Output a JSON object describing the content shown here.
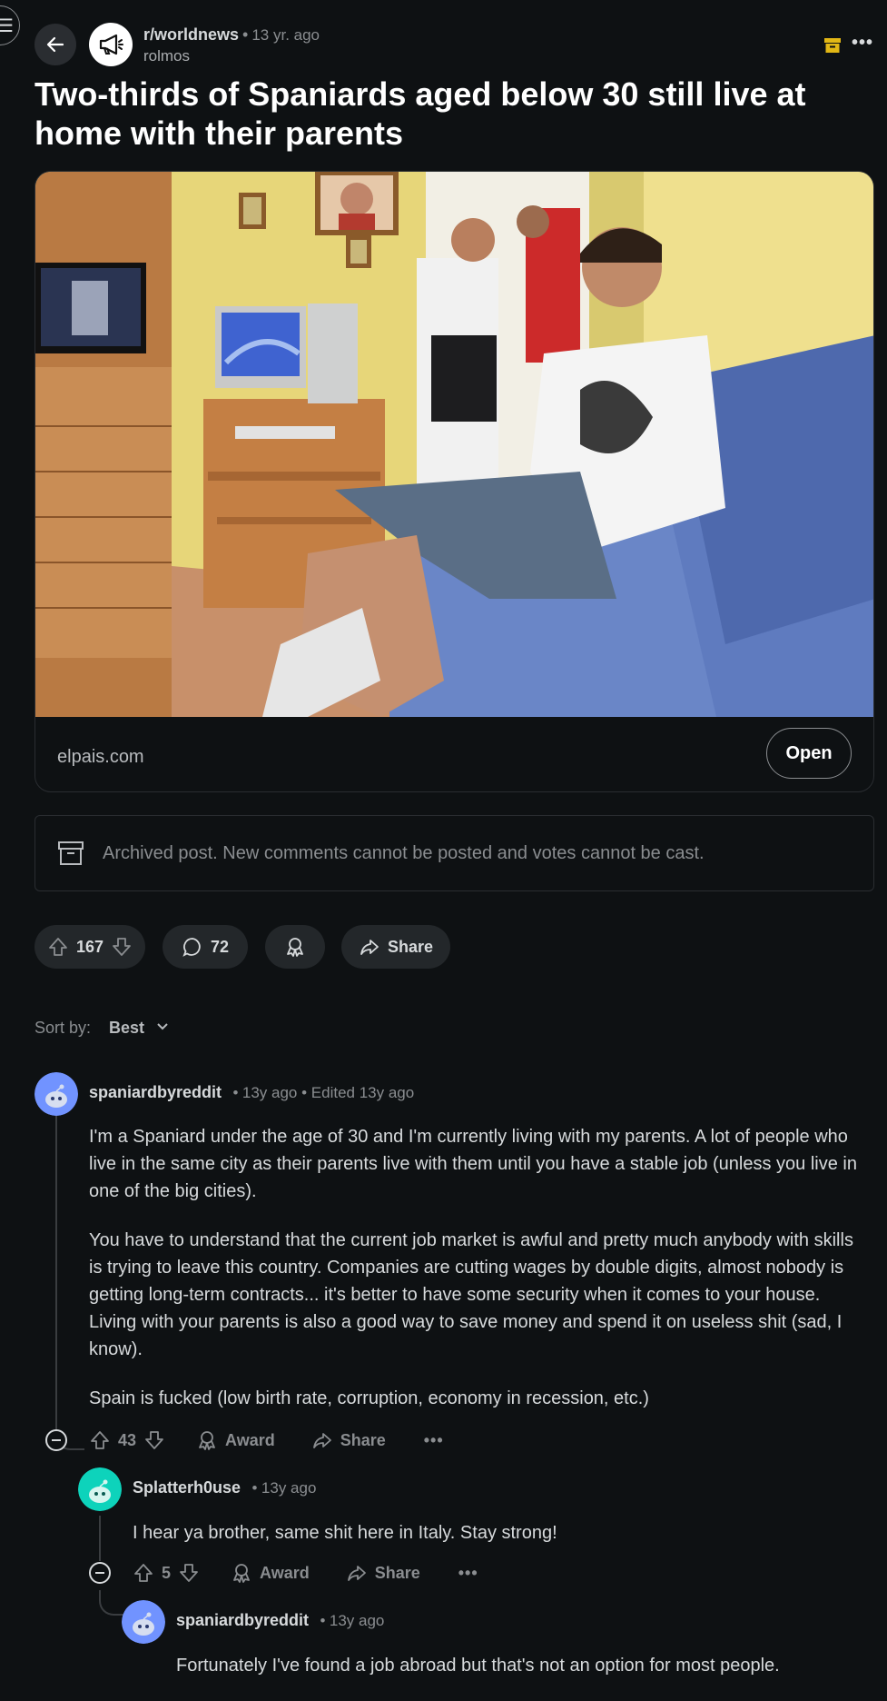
{
  "post": {
    "subreddit": "r/worldnews",
    "time": "13 yr. ago",
    "author": "rolmos",
    "title": "Two-thirds of Spaniards aged below 30 still live at home with their parents",
    "domain": "elpais.com",
    "open_label": "Open",
    "archived_notice": "Archived post. New comments cannot be posted and votes cannot be cast.",
    "votes": "167",
    "comments": "72",
    "share_label": "Share"
  },
  "sort": {
    "label": "Sort by:",
    "value": "Best"
  },
  "comments": [
    {
      "user": "spaniardbyreddit",
      "meta": "13y ago • Edited 13y ago",
      "paragraphs": [
        "I'm a Spaniard under the age of 30 and I'm currently living with my parents. A lot of people who live in the same city as their parents live with them until you have a stable job (unless you live in one of the big cities).",
        "You have to understand that the current job market is awful and pretty much anybody with skills is trying to leave this country. Companies are cutting wages by double digits, almost nobody is getting long-term contracts... it's better to have some security when it comes to your house. Living with your parents is also a good way to save money and spend it on useless shit (sad, I know).",
        "Spain is fucked (low birth rate, corruption, economy in recession, etc.)"
      ],
      "votes": "43",
      "award_label": "Award",
      "share_label": "Share",
      "avatar_color": "#7193ff"
    },
    {
      "user": "Splatterh0use",
      "meta": "13y ago",
      "paragraphs": [
        "I hear ya brother, same shit here in Italy. Stay strong!"
      ],
      "votes": "5",
      "award_label": "Award",
      "share_label": "Share",
      "avatar_color": "#0dd3bb"
    },
    {
      "user": "spaniardbyreddit",
      "meta": "13y ago",
      "paragraphs": [
        "Fortunately I've found a job abroad but that's not an option for most people."
      ],
      "avatar_color": "#7193ff"
    }
  ]
}
